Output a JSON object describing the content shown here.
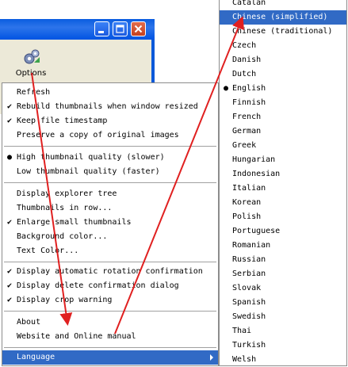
{
  "window": {
    "colors": {
      "title_bar": "#0a5ddf",
      "face": "#ece9d8",
      "close_button": "#c4401f"
    },
    "toolbar": {
      "options_label": "Options",
      "options_icon": "gears-icon"
    },
    "buttons": {
      "minimize_icon": "minimize-icon",
      "maximize_icon": "maximize-icon",
      "close_icon": "close-icon"
    }
  },
  "menu": {
    "items": [
      {
        "label": "Refresh",
        "mark": ""
      },
      {
        "label": "Rebuild thumbnails when window resized",
        "mark": "✔"
      },
      {
        "label": "Keep file timestamp",
        "mark": "✔"
      },
      {
        "label": "Preserve a copy of original images",
        "mark": ""
      },
      {
        "label": "High thumbnail quality (slower)",
        "mark": "●"
      },
      {
        "label": "Low thumbnail quality (faster)",
        "mark": ""
      },
      {
        "label": "Display explorer tree",
        "mark": ""
      },
      {
        "label": "Thumbnails in row...",
        "mark": ""
      },
      {
        "label": "Enlarge small thumbnails",
        "mark": "✔"
      },
      {
        "label": "Background color...",
        "mark": ""
      },
      {
        "label": "Text Color...",
        "mark": ""
      },
      {
        "label": "Display automatic rotation confirmation",
        "mark": "✔"
      },
      {
        "label": "Display delete confirmation dialog",
        "mark": "✔"
      },
      {
        "label": "Display crop warning",
        "mark": "✔"
      },
      {
        "label": "About",
        "mark": ""
      },
      {
        "label": "Website and Online manual",
        "mark": ""
      },
      {
        "label": "Language",
        "mark": ""
      }
    ],
    "selected_color": "#316ac5"
  },
  "language_menu": {
    "items": [
      {
        "label": "Catalan",
        "mark": ""
      },
      {
        "label": "Chinese (simplified)",
        "mark": ""
      },
      {
        "label": "Chinese (traditional)",
        "mark": ""
      },
      {
        "label": "Czech",
        "mark": ""
      },
      {
        "label": "Danish",
        "mark": ""
      },
      {
        "label": "Dutch",
        "mark": ""
      },
      {
        "label": "English",
        "mark": "●"
      },
      {
        "label": "Finnish",
        "mark": ""
      },
      {
        "label": "French",
        "mark": ""
      },
      {
        "label": "German",
        "mark": ""
      },
      {
        "label": "Greek",
        "mark": ""
      },
      {
        "label": "Hungarian",
        "mark": ""
      },
      {
        "label": "Indonesian",
        "mark": ""
      },
      {
        "label": "Italian",
        "mark": ""
      },
      {
        "label": "Korean",
        "mark": ""
      },
      {
        "label": "Polish",
        "mark": ""
      },
      {
        "label": "Portuguese",
        "mark": ""
      },
      {
        "label": "Romanian",
        "mark": ""
      },
      {
        "label": "Russian",
        "mark": ""
      },
      {
        "label": "Serbian",
        "mark": ""
      },
      {
        "label": "Slovak",
        "mark": ""
      },
      {
        "label": "Spanish",
        "mark": ""
      },
      {
        "label": "Swedish",
        "mark": ""
      },
      {
        "label": "Thai",
        "mark": ""
      },
      {
        "label": "Turkish",
        "mark": ""
      },
      {
        "label": "Welsh",
        "mark": ""
      }
    ]
  },
  "annotation": {
    "arrow_color": "#e02020"
  }
}
